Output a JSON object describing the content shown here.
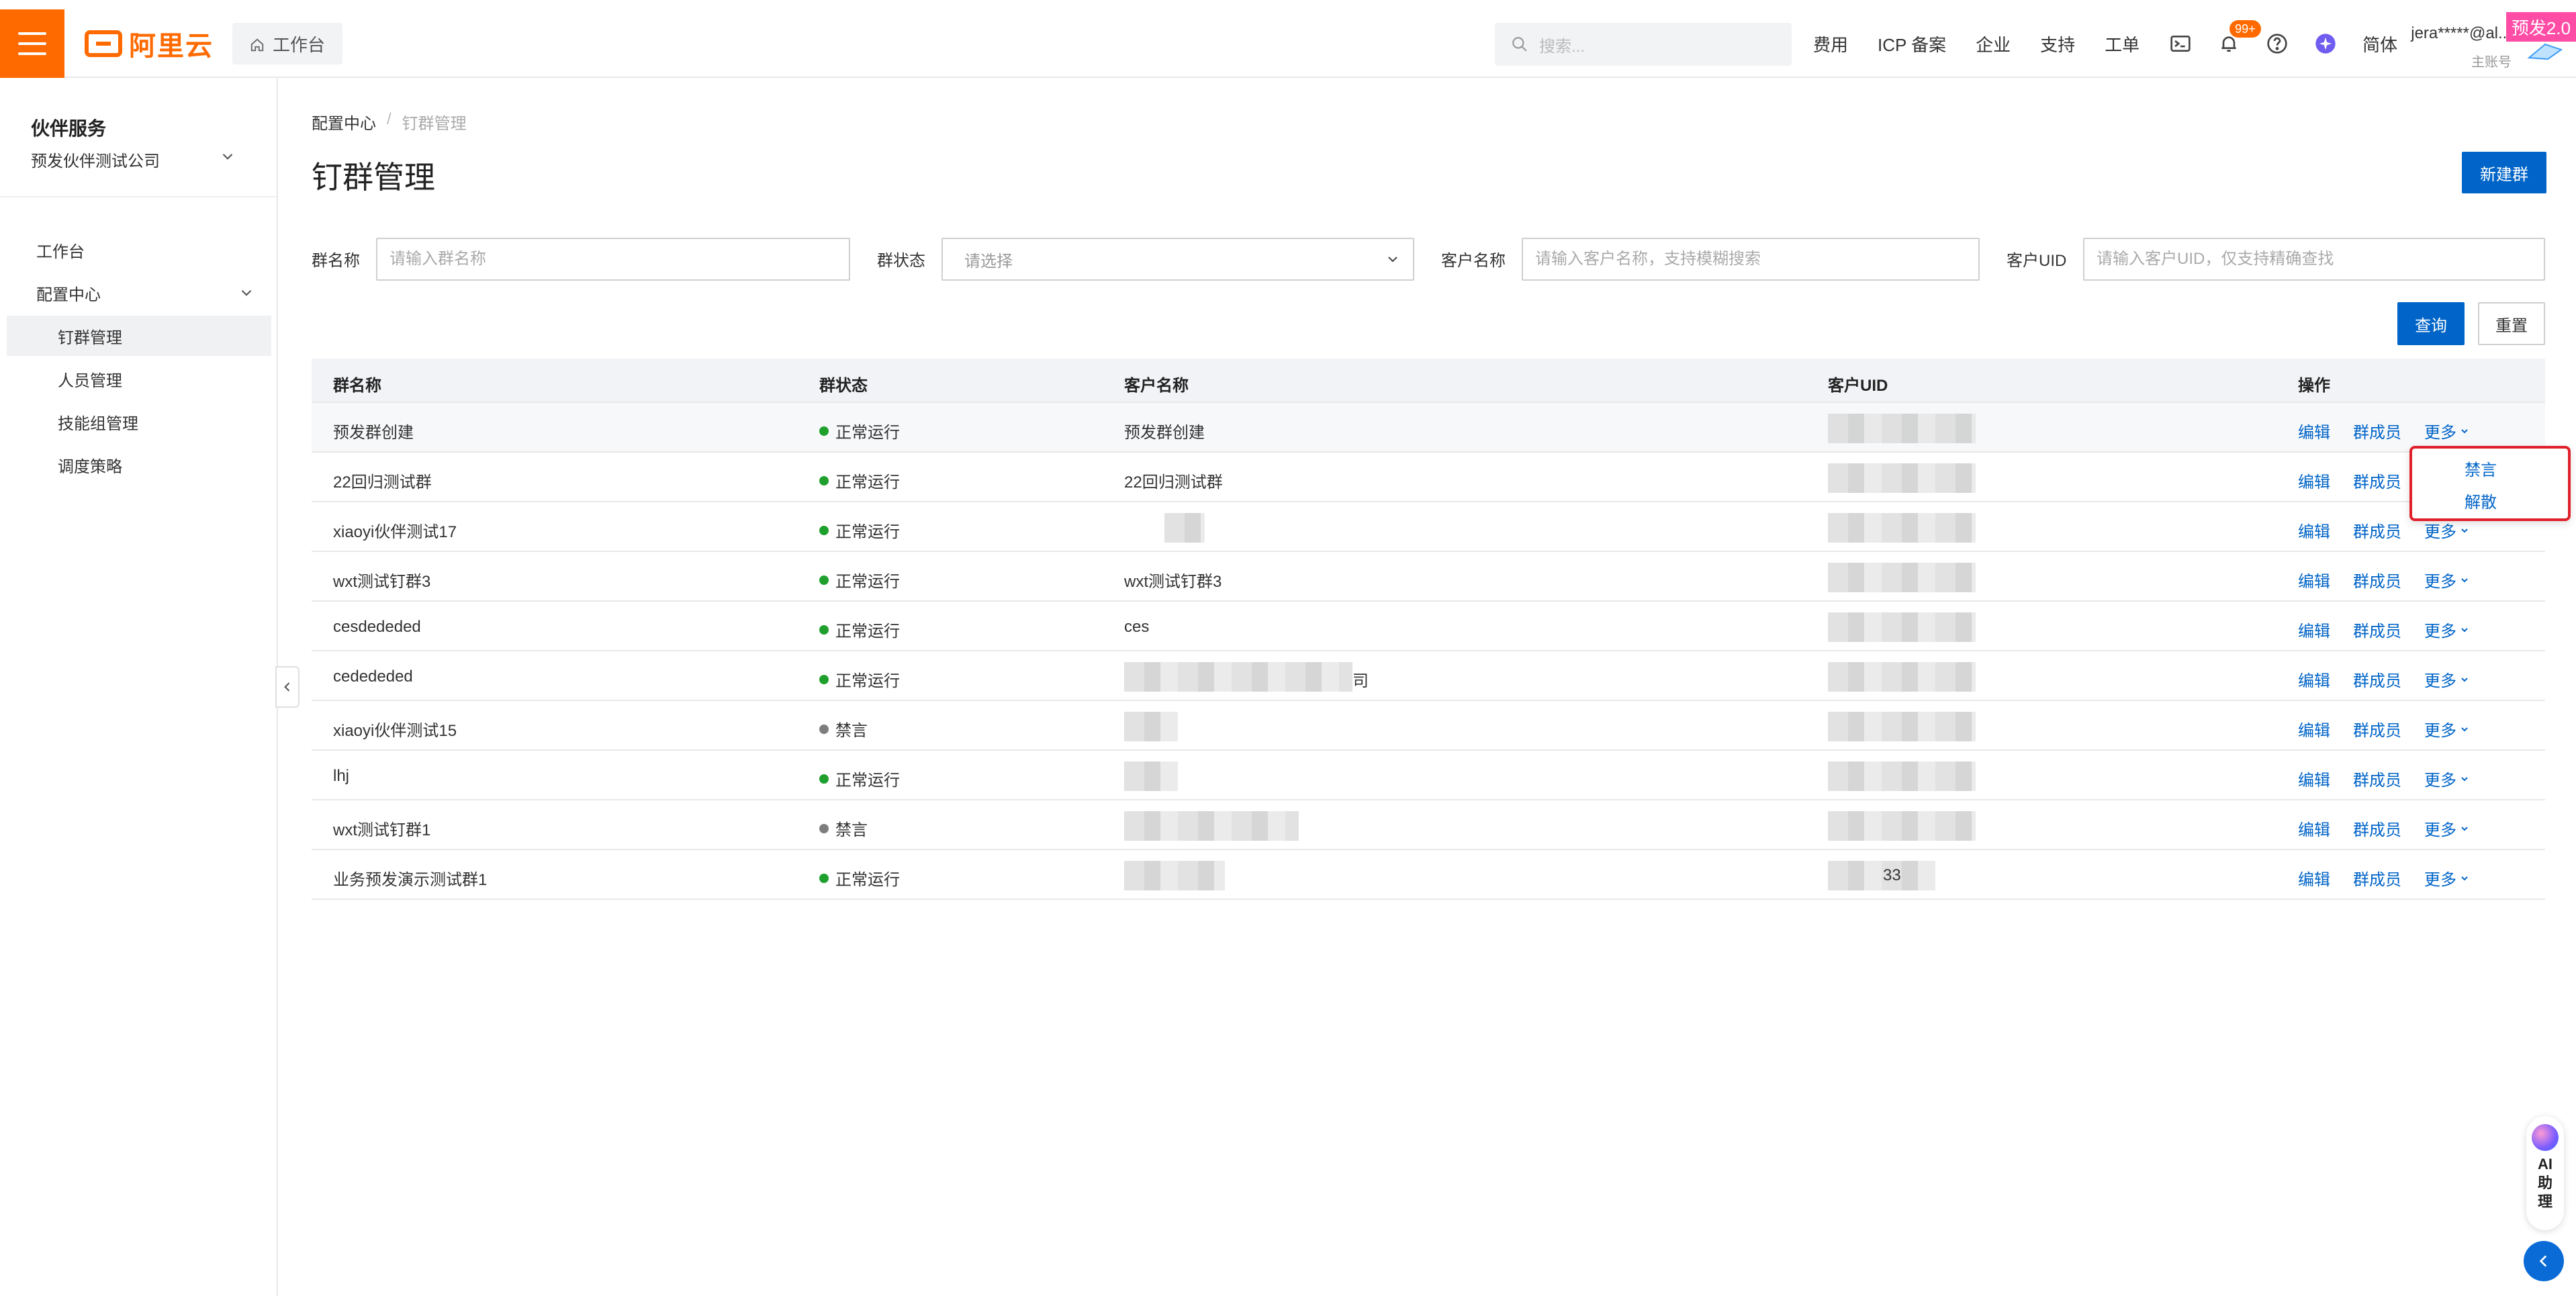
{
  "header": {
    "logo_text": "阿里云",
    "home_tab": "工作台",
    "search_placeholder": "搜索...",
    "nav": [
      "费用",
      "ICP 备案",
      "企业",
      "支持",
      "工单"
    ],
    "notification_badge": "99+",
    "lang": "简体",
    "user_name": "jera*****@al...",
    "user_sub": "主账号",
    "env_tag": "预发2.0"
  },
  "sidebar": {
    "title": "伙伴服务",
    "company": "预发伙伴测试公司",
    "items": [
      {
        "label": "工作台"
      },
      {
        "label": "配置中心"
      },
      {
        "label": "钉群管理"
      },
      {
        "label": "人员管理"
      },
      {
        "label": "技能组管理"
      },
      {
        "label": "调度策略"
      }
    ]
  },
  "breadcrumb": {
    "parent": "配置中心",
    "separator": "/",
    "current": "钉群管理"
  },
  "page": {
    "title": "钉群管理",
    "new_button": "新建群"
  },
  "filters": {
    "group_name_label": "群名称",
    "group_name_placeholder": "请输入群名称",
    "status_label": "群状态",
    "status_placeholder": "请选择",
    "customer_name_label": "客户名称",
    "customer_name_placeholder": "请输入客户名称，支持模糊搜索",
    "customer_uid_label": "客户UID",
    "customer_uid_placeholder": "请输入客户UID，仅支持精确查找",
    "query_button": "查询",
    "reset_button": "重置"
  },
  "table": {
    "columns": [
      "群名称",
      "群状态",
      "客户名称",
      "客户UID",
      "操作"
    ],
    "actions": {
      "edit": "编辑",
      "members": "群成员",
      "more": "更多"
    },
    "rows": [
      {
        "name": "预发群创建",
        "status": "正常运行",
        "status_color": "green",
        "customer": "预发群创建",
        "uid_suffix": ""
      },
      {
        "name": "22回归测试群",
        "status": "正常运行",
        "status_color": "green",
        "customer": "22回归测试群",
        "uid_suffix": ""
      },
      {
        "name": "xiaoyi伙伴测试17",
        "status": "正常运行",
        "status_color": "green",
        "customer": "",
        "uid_suffix": ""
      },
      {
        "name": "wxt测试钉群3",
        "status": "正常运行",
        "status_color": "green",
        "customer": "wxt测试钉群3",
        "uid_suffix": ""
      },
      {
        "name": "cesdededed",
        "status": "正常运行",
        "status_color": "green",
        "customer": "ces",
        "uid_suffix": ""
      },
      {
        "name": "cedededed",
        "status": "正常运行",
        "status_color": "green",
        "customer": "司",
        "uid_suffix": ""
      },
      {
        "name": "xiaoyi伙伴测试15",
        "status": "禁言",
        "status_color": "gray",
        "customer": "",
        "uid_suffix": ""
      },
      {
        "name": "lhj",
        "status": "正常运行",
        "status_color": "green",
        "customer": "",
        "uid_suffix": ""
      },
      {
        "name": "wxt测试钉群1",
        "status": "禁言",
        "status_color": "gray",
        "customer": "",
        "uid_suffix": ""
      },
      {
        "name": "业务预发演示测试群1",
        "status": "正常运行",
        "status_color": "green",
        "customer": "",
        "uid_suffix": "33"
      }
    ]
  },
  "more_menu": {
    "items": [
      "禁言",
      "解散"
    ]
  },
  "ai_assistant": {
    "label": "AI助理"
  },
  "colors": {
    "brand": "#ff6a00",
    "primary": "#0064c8",
    "status_green": "#1fa02d",
    "status_gray": "#7d7d7d",
    "highlight": "#e0202a"
  }
}
